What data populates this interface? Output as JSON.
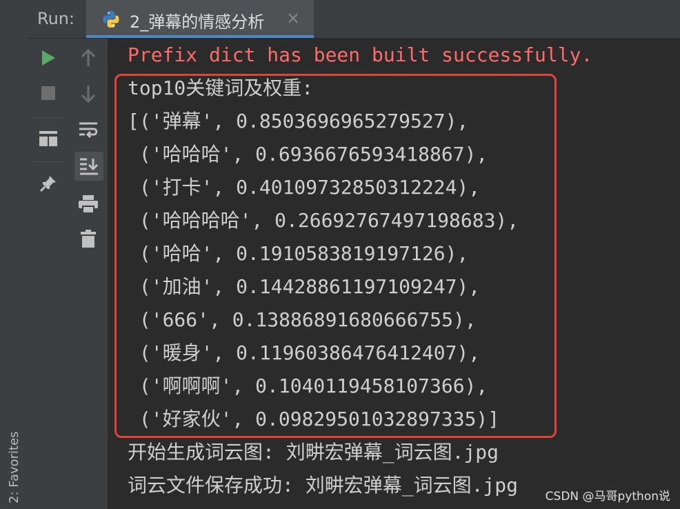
{
  "panel": {
    "run_label": "Run:",
    "tab_title": "2_弹幕的情感分析",
    "close_glyph": "×"
  },
  "favorites": {
    "label": "2: Favorites"
  },
  "console": {
    "lines": [
      "Prefix dict has been built successfully.",
      "top10关键词及权重:",
      "[('弹幕', 0.8503696965279527),",
      " ('哈哈哈', 0.6936676593418867),",
      " ('打卡', 0.40109732850312224),",
      " ('哈哈哈哈', 0.26692767497198683),",
      " ('哈哈', 0.1910583819197126),",
      " ('加油', 0.14428861197109247),",
      " ('666', 0.13886891680666755),",
      " ('暖身', 0.11960386476412407),",
      " ('啊啊啊', 0.1040119458107366),",
      " ('好家伙', 0.09829501032897335)]",
      "开始生成词云图: 刘畊宏弹幕_词云图.jpg",
      "词云文件保存成功: 刘畊宏弹幕_词云图.jpg"
    ]
  },
  "watermark": "CSDN @马哥python说",
  "colors": {
    "background": "#2b2b2b",
    "panel": "#3c3f41",
    "error_text": "#ff6b68",
    "normal_text": "#cfcfcf",
    "highlight_border": "#e3433c",
    "run_green": "#59a869",
    "tab_underline": "#4a88c7"
  }
}
